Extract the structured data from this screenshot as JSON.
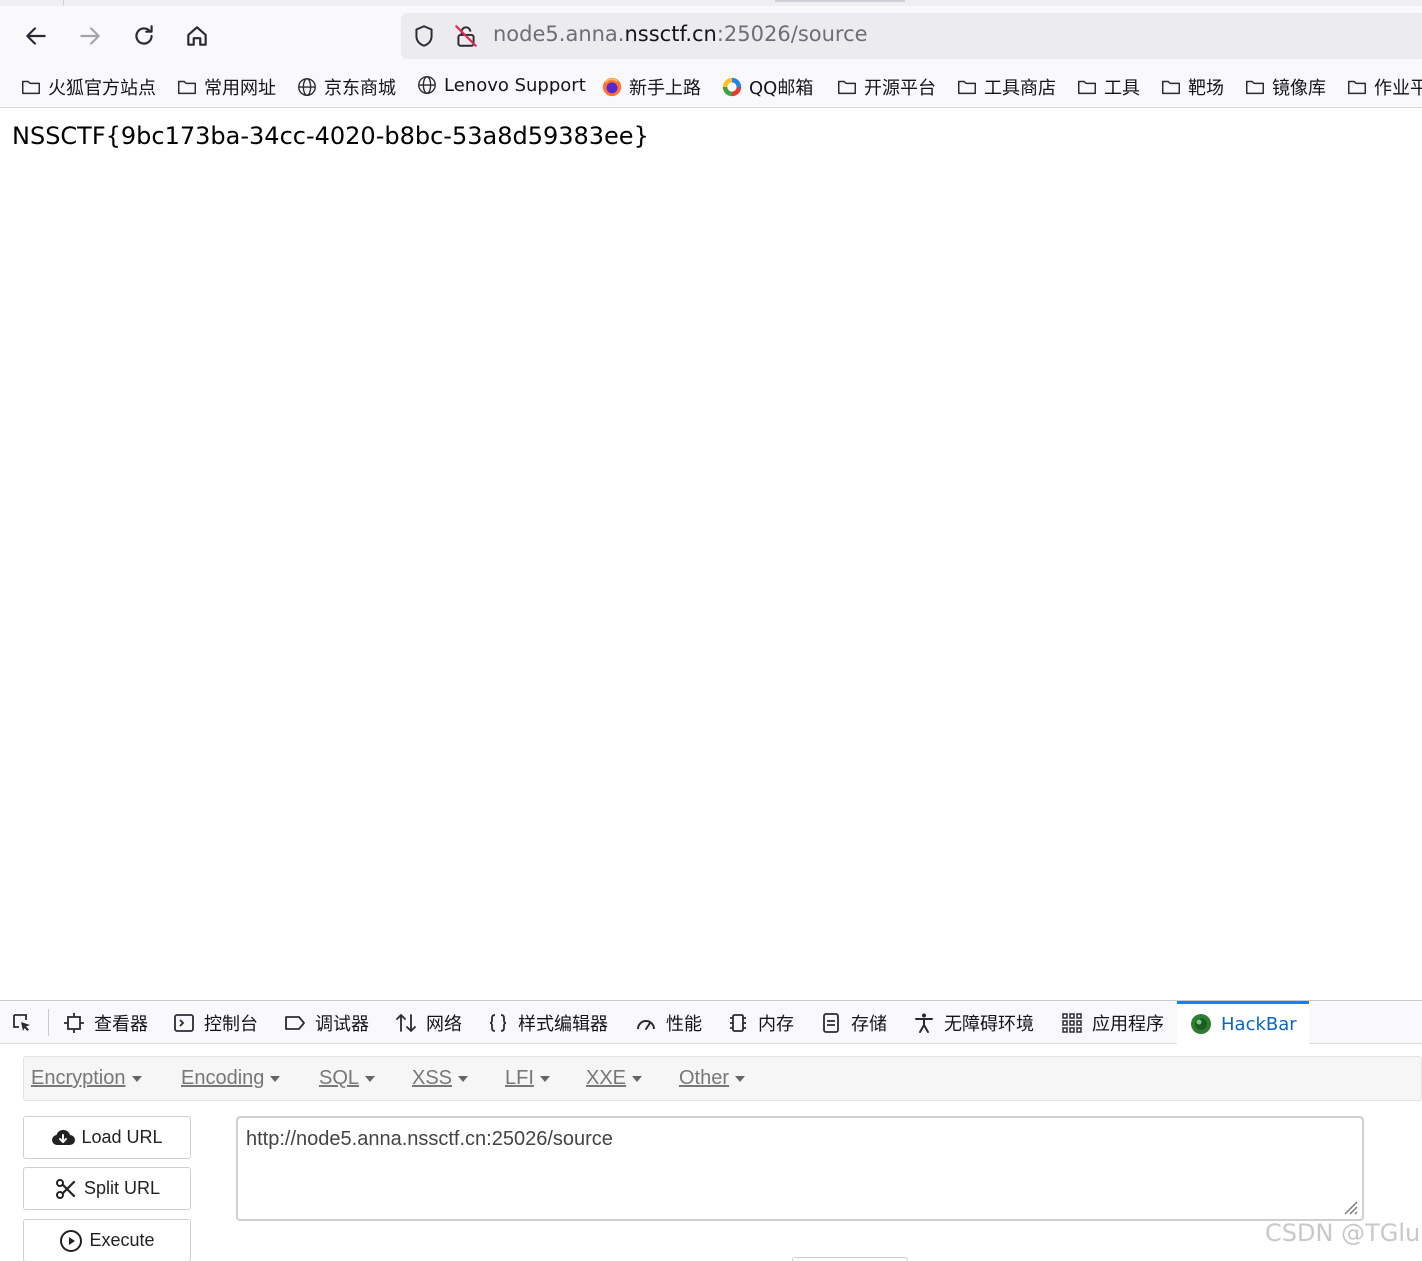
{
  "browser": {
    "url_prefix": "node5.anna.",
    "url_domain": "nssctf.cn",
    "url_suffix": ":25026/source"
  },
  "bookmarks": [
    {
      "label": "火狐官方站点",
      "icon": "folder-icon"
    },
    {
      "label": "常用网址",
      "icon": "folder-icon"
    },
    {
      "label": "京东商城",
      "icon": "globe-icon"
    },
    {
      "label": "Lenovo Support",
      "icon": "globe-icon"
    },
    {
      "label": "新手上路",
      "icon": "firefox-icon"
    },
    {
      "label": "QQ邮箱",
      "icon": "qq-mail-icon"
    },
    {
      "label": "开源平台",
      "icon": "folder-icon"
    },
    {
      "label": "工具商店",
      "icon": "folder-icon"
    },
    {
      "label": "工具",
      "icon": "folder-icon"
    },
    {
      "label": "靶场",
      "icon": "folder-icon"
    },
    {
      "label": "镜像库",
      "icon": "folder-icon"
    },
    {
      "label": "作业平",
      "icon": "folder-icon"
    }
  ],
  "page": {
    "flag": "NSSCTF{9bc173ba-34cc-4020-b8bc-53a8d59383ee}"
  },
  "devtools": {
    "tabs": [
      {
        "label": "查看器",
        "icon": "inspector-icon"
      },
      {
        "label": "控制台",
        "icon": "console-icon"
      },
      {
        "label": "调试器",
        "icon": "debugger-icon"
      },
      {
        "label": "网络",
        "icon": "network-icon"
      },
      {
        "label": "样式编辑器",
        "icon": "style-editor-icon"
      },
      {
        "label": "性能",
        "icon": "performance-icon"
      },
      {
        "label": "内存",
        "icon": "memory-icon"
      },
      {
        "label": "存储",
        "icon": "storage-icon"
      },
      {
        "label": "无障碍环境",
        "icon": "accessibility-icon"
      },
      {
        "label": "应用程序",
        "icon": "application-icon"
      },
      {
        "label": "HackBar",
        "icon": "hackbar-icon",
        "active": true
      }
    ]
  },
  "hackbar": {
    "menus": [
      "Encryption",
      "Encoding",
      "SQL",
      "XSS",
      "LFI",
      "XXE",
      "Other"
    ],
    "load_url": "Load URL",
    "split_url": "Split URL",
    "execute": "Execute",
    "url_value": "http://node5.anna.nssctf.cn:25026/source"
  },
  "watermark": "CSDN @TGlu",
  "colors": {
    "accent": "#0a84ff",
    "active_tab_text": "#0a67c6"
  }
}
